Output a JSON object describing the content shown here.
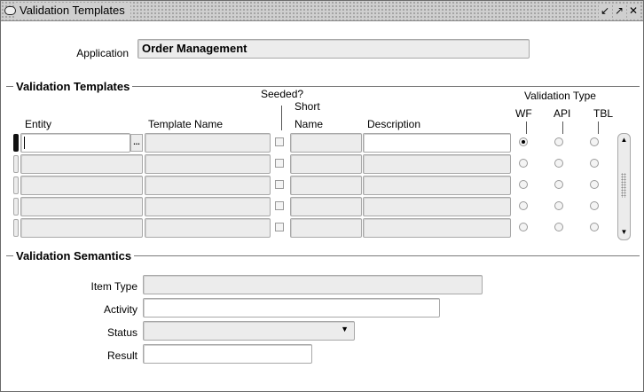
{
  "window": {
    "title": "Validation Templates"
  },
  "application": {
    "label": "Application",
    "value": "Order Management"
  },
  "templates": {
    "section_title": "Validation Templates",
    "col_entity": "Entity",
    "col_template_name": "Template Name",
    "col_seeded": "Seeded?",
    "col_short_name_1": "Short",
    "col_short_name_2": "Name",
    "col_description": "Description",
    "col_validation_type": "Validation Type",
    "type_wf": "WF",
    "type_api": "API",
    "type_tbl": "TBL",
    "lov_glyph": "..."
  },
  "semantics": {
    "section_title": "Validation Semantics",
    "item_type_label": "Item Type",
    "activity_label": "Activity",
    "status_label": "Status",
    "result_label": "Result"
  },
  "icons": {
    "minimize": "minimize-icon",
    "maximize": "maximize-icon",
    "close": "close-icon",
    "dropdown": "chevron-down-icon"
  }
}
